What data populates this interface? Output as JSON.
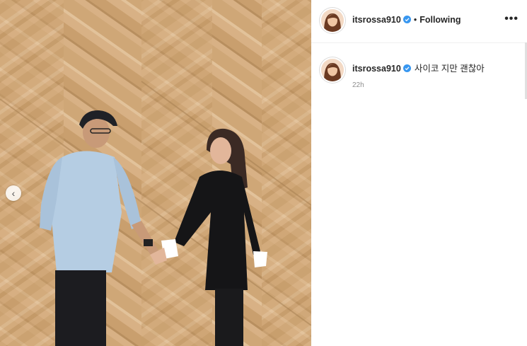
{
  "post": {
    "username": "itsrossa910",
    "separator": "•",
    "follow_status": "Following",
    "more_label": "•••",
    "caption_text": "사이코 지만 괜찮아",
    "timestamp": "22h",
    "verified_icon": "verified-badge-icon",
    "prev_icon": "chevron-left-icon",
    "colors": {
      "verified": "#3897f0",
      "text": "#262626",
      "muted": "#8e8e8e"
    }
  }
}
